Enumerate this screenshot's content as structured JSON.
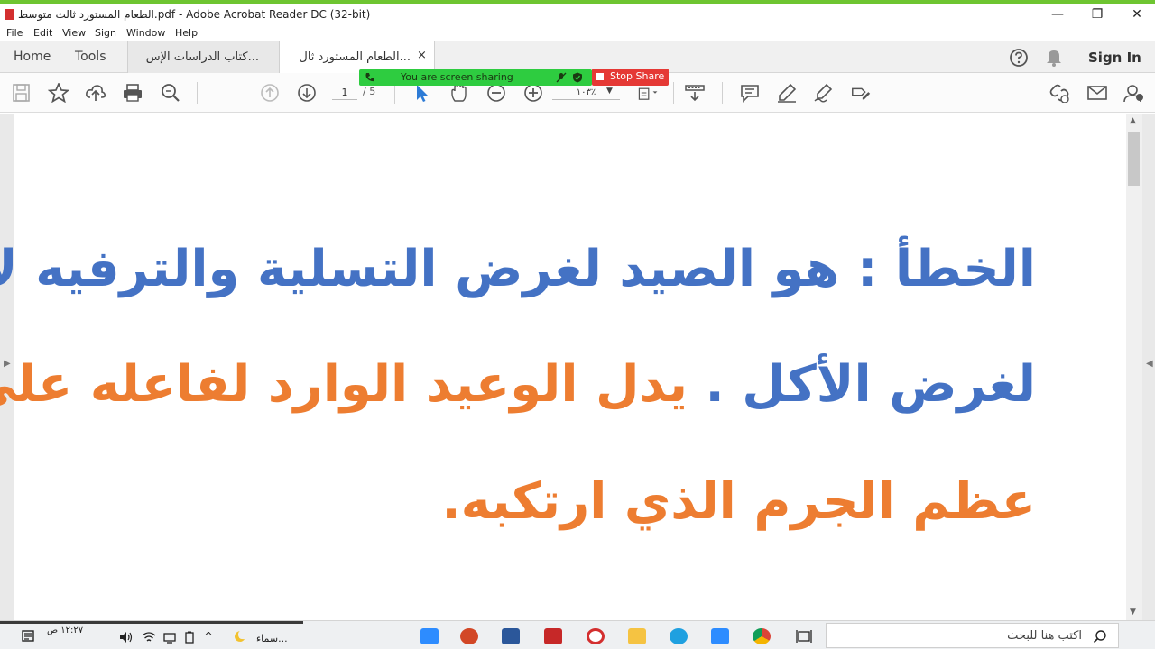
{
  "window": {
    "title": "الطعام المستورد ثالث متوسط.pdf - Adobe Acrobat Reader DC (32-bit)",
    "minimize_glyph": "—",
    "restore_glyph": "❐",
    "close_glyph": "✕"
  },
  "menu": {
    "items": [
      "File",
      "Edit",
      "View",
      "Sign",
      "Window",
      "Help"
    ]
  },
  "tabs": {
    "home": "Home",
    "tools": "Tools",
    "doc_tabs": [
      {
        "label": "كتاب الدراسات الإس..."
      },
      {
        "label": "الطعام المستورد ثال...",
        "close": "×"
      }
    ],
    "sign_in": "Sign In"
  },
  "toolbar": {
    "page_current": "1",
    "page_total": "/ 5",
    "zoom": "١٠٣٪",
    "zoom_caret": "▼"
  },
  "screen_share": {
    "banner_text": "You are screen sharing",
    "stop_label": "Stop Share"
  },
  "document": {
    "lines": [
      {
        "text": "الخطأ : هو الصيد لغرض التسلية والترفيه لا",
        "color": "blue"
      },
      {
        "text_blue": "لغرض الأكل .",
        "text_orange": " يدل الوعيد الوارد لفاعله على"
      },
      {
        "text": "عظم الجرم الذي ارتكبه.",
        "color": "orange"
      }
    ]
  },
  "taskbar": {
    "search_placeholder": "اكتب هنا للبحث",
    "clock_time": "١٢:٢٧ ص",
    "tray_label": "سماء..."
  },
  "colors": {
    "blue_text": "#4472c4",
    "orange_text": "#ed7d31",
    "share_green": "#2ecc40",
    "stop_red": "#e53935"
  },
  "icons": [
    "save-icon",
    "star-icon",
    "upload-icon",
    "print-icon",
    "search-zoom-icon",
    "page-up-icon",
    "page-down-icon",
    "select-cursor-icon",
    "hand-icon",
    "zoom-out-icon",
    "zoom-in-icon",
    "fit-page-icon",
    "scroll-mode-icon",
    "comment-icon",
    "highlight-icon",
    "sign-icon",
    "edit-icon",
    "share-link-icon",
    "mail-icon",
    "account-icon",
    "help-icon",
    "bell-icon"
  ]
}
